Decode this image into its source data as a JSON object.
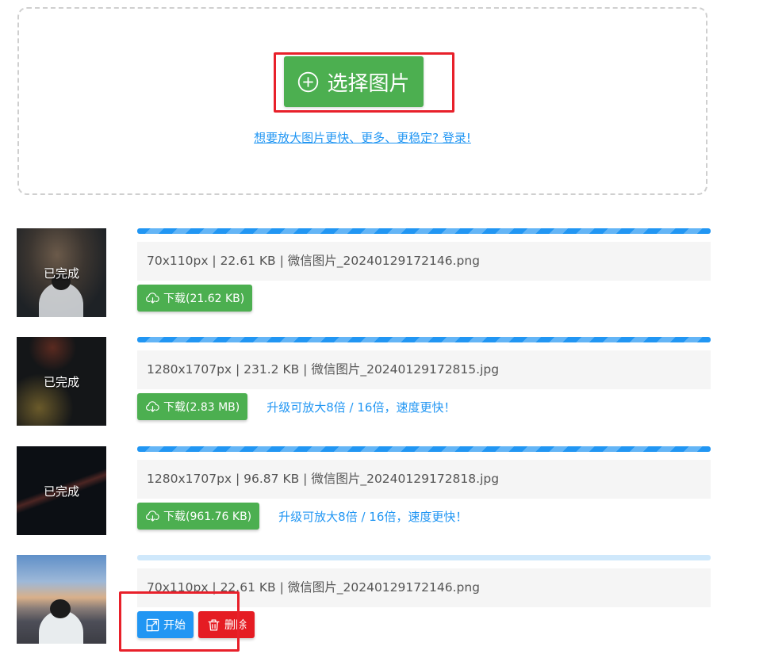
{
  "upload": {
    "choose_label": "选择图片",
    "login_link": "想要放大图片更快、更多、更稳定? 登录!"
  },
  "files": [
    {
      "status": "已完成",
      "info": "70x110px | 22.61 KB | 微信图片_20240129172146.png",
      "download_label": "下载(21.62 KB)"
    },
    {
      "status": "已完成",
      "info": "1280x1707px | 231.2 KB | 微信图片_20240129172815.jpg",
      "download_label": "下载(2.83 MB)",
      "upgrade_label": "升级可放大8倍 / 16倍，速度更快！"
    },
    {
      "status": "已完成",
      "info": "1280x1707px | 96.87 KB | 微信图片_20240129172818.jpg",
      "download_label": "下载(961.76 KB)",
      "upgrade_label": "升级可放大8倍 / 16倍，速度更快！"
    },
    {
      "info": "70x110px | 22.61 KB | 微信图片_20240129172146.png",
      "start_label": "开始",
      "delete_label": "删除"
    }
  ],
  "colors": {
    "primary_green": "#4caf50",
    "accent_blue": "#2196f3",
    "danger_red": "#e51c23",
    "highlight_red": "#e8202a"
  }
}
